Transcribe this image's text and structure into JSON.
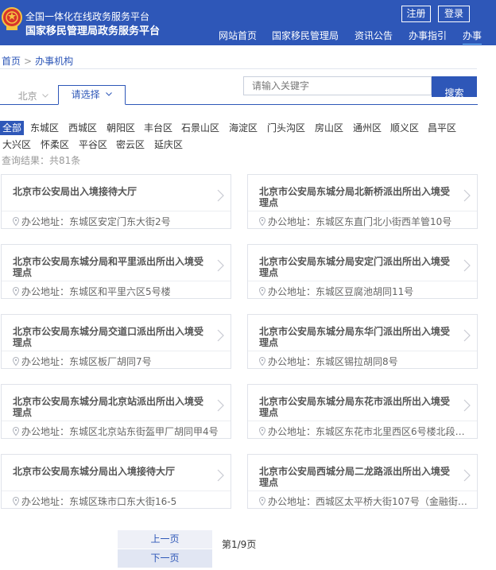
{
  "header": {
    "site_line1": "全国一体化在线政务服务平台",
    "site_line2": "国家移民管理局政务服务平台",
    "register_label": "注册",
    "login_label": "登录",
    "nav": [
      "网站首页",
      "国家移民管理局",
      "资讯公告",
      "办事指引",
      "办事"
    ]
  },
  "breadcrumb": {
    "home": "首页",
    "separator": ">",
    "current": "办事机构"
  },
  "tabs": {
    "city": "北京",
    "select": "请选择"
  },
  "search": {
    "placeholder": "请输入关键字",
    "button_label": "搜索"
  },
  "districts": [
    "全部",
    "东城区",
    "西城区",
    "朝阳区",
    "丰台区",
    "石景山区",
    "海淀区",
    "门头沟区",
    "房山区",
    "通州区",
    "顺义区",
    "昌平区",
    "大兴区",
    "怀柔区",
    "平谷区",
    "密云区",
    "延庆区"
  ],
  "result_count": "查询结果：共81条",
  "cards": [
    {
      "title": "北京市公安局出入境接待大厅",
      "address": "办公地址：东城区安定门东大街2号"
    },
    {
      "title": "北京市公安局东城分局北新桥派出所出入境受理点",
      "address": "办公地址：东城区东直门北小街西羊管10号"
    },
    {
      "title": "北京市公安局东城分局和平里派出所出入境受理点",
      "address": "办公地址：东城区和平里六区5号楼"
    },
    {
      "title": "北京市公安局东城分局安定门派出所出入境受理点",
      "address": "办公地址：东城区豆腐池胡同11号"
    },
    {
      "title": "北京市公安局东城分局交道口派出所出入境受理点",
      "address": "办公地址：东城区板厂胡同7号"
    },
    {
      "title": "北京市公安局东城分局东华门派出所出入境受理点",
      "address": "办公地址：东城区锡拉胡同8号"
    },
    {
      "title": "北京市公安局东城分局北京站派出所出入境受理点",
      "address": "办公地址：东城区北京站东街盔甲厂胡同甲4号"
    },
    {
      "title": "北京市公安局东城分局东花市派出所出入境受理点",
      "address": "办公地址：东城区东花市北里西区6号楼北段地..."
    },
    {
      "title": "北京市公安局东城分局出入境接待大厅",
      "address": "办公地址：东城区珠市口东大街16-5"
    },
    {
      "title": "北京市公安局西城分局二龙路派出所出入境受理点",
      "address": "办公地址：西城区太平桥大街107号（金融街街..."
    }
  ],
  "pagination": {
    "prev_label": "上一页",
    "next_label": "下一页",
    "page_info": "第1/9页"
  },
  "colors": {
    "primary": "#2e57b8",
    "nav_active": "#6fc0ff"
  },
  "icons": {
    "emblem": "national-emblem-icon",
    "card_arrow": "chevron-right-icon",
    "address": "location-pin-icon",
    "tab": "chevron-down-icon"
  }
}
